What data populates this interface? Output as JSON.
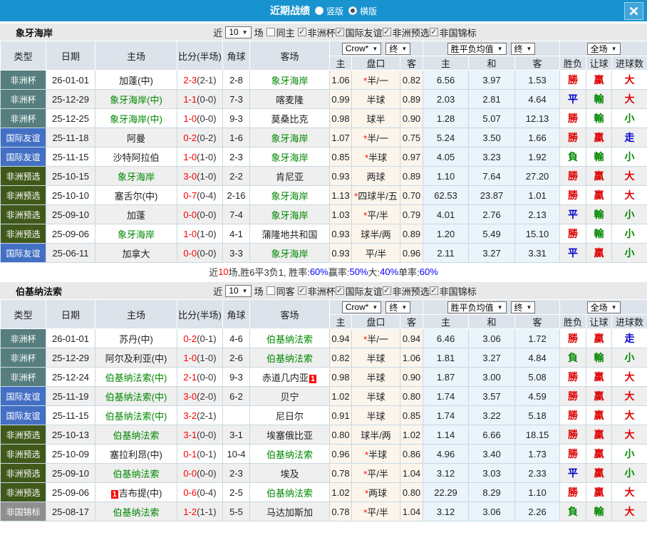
{
  "titlebar": {
    "title": "近期战绩",
    "radio_vertical": "竖版",
    "radio_horizontal": "横版"
  },
  "table_controls": {
    "odds_source": "Crow*",
    "odds_stage": "终",
    "mean_label": "胜平负均值",
    "mean_stage": "终",
    "scope": "全场",
    "dropdown_arrow": "▼"
  },
  "table_columns": {
    "type": "类型",
    "date": "日期",
    "home": "主场",
    "score": "比分(半场)",
    "corner": "角球",
    "away": "客场",
    "odds_home": "主",
    "handicap": "盘口",
    "odds_away": "客",
    "mean_home": "主",
    "mean_draw": "和",
    "mean_away": "客",
    "wdl": "胜负",
    "handicap_result": "让球",
    "goals": "进球数"
  },
  "colors": {
    "titlebar_bg": "#1993d0",
    "type_colors": {
      "非洲杯": "#567e7e",
      "国际友谊": "#4470c4",
      "非洲预选": "#40591b",
      "非国锦标": "#8f8f8f"
    },
    "result_colors": {
      "勝": "#dd0000",
      "贏": "#dd0000",
      "大": "#dd0000",
      "平": "#0000cc",
      "走": "#0000cc",
      "負": "#008800",
      "輸": "#008800",
      "小": "#008800"
    },
    "team_highlight": "#008800",
    "score_red": "#fe0000",
    "percent_blue": "#0000ff"
  },
  "sections": [
    {
      "team": "象牙海岸",
      "filter": {
        "near_label": "近",
        "count": "10",
        "games_label": "场",
        "same_label": "同主",
        "same_checked": false,
        "competitions": [
          {
            "label": "非洲杯",
            "checked": true
          },
          {
            "label": "国际友谊",
            "checked": true
          },
          {
            "label": "非洲预选",
            "checked": true
          },
          {
            "label": "非国锦标",
            "checked": true
          }
        ]
      },
      "rows": [
        {
          "type": "非洲杯",
          "date": "26-01-01",
          "home": "加蓬(中)",
          "home_green": false,
          "score": "2-3",
          "half": "(2-1)",
          "corner": "2-8",
          "away": "象牙海岸",
          "away_green": true,
          "o_home": "1.06",
          "star": true,
          "handicap": "半/一",
          "o_away": "0.82",
          "m_home": "6.56",
          "m_draw": "3.97",
          "m_away": "1.53",
          "r_wdl": "勝",
          "r_asia": "贏",
          "r_goal": "大"
        },
        {
          "type": "非洲杯",
          "date": "25-12-29",
          "home": "象牙海岸(中)",
          "home_green": true,
          "score": "1-1",
          "half": "(0-0)",
          "corner": "7-3",
          "away": "喀麦隆",
          "away_green": false,
          "o_home": "0.99",
          "star": false,
          "handicap": "半球",
          "o_away": "0.89",
          "m_home": "2.03",
          "m_draw": "2.81",
          "m_away": "4.64",
          "r_wdl": "平",
          "r_asia": "輸",
          "r_goal": "大"
        },
        {
          "type": "非洲杯",
          "date": "25-12-25",
          "home": "象牙海岸(中)",
          "home_green": true,
          "score": "1-0",
          "half": "(0-0)",
          "corner": "9-3",
          "away": "莫桑比克",
          "away_green": false,
          "o_home": "0.98",
          "star": false,
          "handicap": "球半",
          "o_away": "0.90",
          "m_home": "1.28",
          "m_draw": "5.07",
          "m_away": "12.13",
          "r_wdl": "勝",
          "r_asia": "輸",
          "r_goal": "小"
        },
        {
          "type": "国际友谊",
          "date": "25-11-18",
          "home": "阿曼",
          "home_green": false,
          "score": "0-2",
          "half": "(0-2)",
          "corner": "1-6",
          "away": "象牙海岸",
          "away_green": true,
          "o_home": "1.07",
          "star": true,
          "handicap": "半/一",
          "o_away": "0.75",
          "m_home": "5.24",
          "m_draw": "3.50",
          "m_away": "1.66",
          "r_wdl": "勝",
          "r_asia": "贏",
          "r_goal": "走"
        },
        {
          "type": "国际友谊",
          "date": "25-11-15",
          "home": "沙特阿拉伯",
          "home_green": false,
          "score": "1-0",
          "half": "(1-0)",
          "corner": "2-3",
          "away": "象牙海岸",
          "away_green": true,
          "o_home": "0.85",
          "star": true,
          "handicap": "半球",
          "o_away": "0.97",
          "m_home": "4.05",
          "m_draw": "3.23",
          "m_away": "1.92",
          "r_wdl": "負",
          "r_asia": "輸",
          "r_goal": "小"
        },
        {
          "type": "非洲预选",
          "date": "25-10-15",
          "home": "象牙海岸",
          "home_green": true,
          "score": "3-0",
          "half": "(1-0)",
          "corner": "2-2",
          "away": "肯尼亚",
          "away_green": false,
          "o_home": "0.93",
          "star": false,
          "handicap": "两球",
          "o_away": "0.89",
          "m_home": "1.10",
          "m_draw": "7.64",
          "m_away": "27.20",
          "r_wdl": "勝",
          "r_asia": "贏",
          "r_goal": "大"
        },
        {
          "type": "非洲预选",
          "date": "25-10-10",
          "home": "塞舌尔(中)",
          "home_green": false,
          "score": "0-7",
          "half": "(0-4)",
          "corner": "2-16",
          "away": "象牙海岸",
          "away_green": true,
          "o_home": "1.13",
          "star": true,
          "handicap": "四球半/五",
          "o_away": "0.70",
          "m_home": "62.53",
          "m_draw": "23.87",
          "m_away": "1.01",
          "r_wdl": "勝",
          "r_asia": "贏",
          "r_goal": "大"
        },
        {
          "type": "非洲预选",
          "date": "25-09-10",
          "home": "加蓬",
          "home_green": false,
          "score": "0-0",
          "half": "(0-0)",
          "corner": "7-4",
          "away": "象牙海岸",
          "away_green": true,
          "o_home": "1.03",
          "star": true,
          "handicap": "平/半",
          "o_away": "0.79",
          "m_home": "4.01",
          "m_draw": "2.76",
          "m_away": "2.13",
          "r_wdl": "平",
          "r_asia": "輸",
          "r_goal": "小"
        },
        {
          "type": "非洲预选",
          "date": "25-09-06",
          "home": "象牙海岸",
          "home_green": true,
          "score": "1-0",
          "half": "(1-0)",
          "corner": "4-1",
          "away": "蒲隆地共和国",
          "away_green": false,
          "o_home": "0.93",
          "star": false,
          "handicap": "球半/两",
          "o_away": "0.89",
          "m_home": "1.20",
          "m_draw": "5.49",
          "m_away": "15.10",
          "r_wdl": "勝",
          "r_asia": "輸",
          "r_goal": "小"
        },
        {
          "type": "国际友谊",
          "date": "25-06-11",
          "home": "加拿大",
          "home_green": false,
          "score": "0-0",
          "half": "(0-0)",
          "corner": "3-3",
          "away": "象牙海岸",
          "away_green": true,
          "o_home": "0.93",
          "star": false,
          "handicap": "平/半",
          "o_away": "0.96",
          "m_home": "2.11",
          "m_draw": "3.27",
          "m_away": "3.31",
          "r_wdl": "平",
          "r_asia": "贏",
          "r_goal": "小"
        }
      ],
      "summary": [
        {
          "t": "近",
          "c": "#333333"
        },
        {
          "t": "10",
          "c": "#ff0000"
        },
        {
          "t": "场,胜6平3负1, 胜率:",
          "c": "#333333"
        },
        {
          "t": "60%",
          "c": "#0000ff"
        },
        {
          "t": " 赢率:",
          "c": "#333333"
        },
        {
          "t": "50%",
          "c": "#0000ff"
        },
        {
          "t": " 大:",
          "c": "#333333"
        },
        {
          "t": "40%",
          "c": "#0000ff"
        },
        {
          "t": " 单率:",
          "c": "#333333"
        },
        {
          "t": "60%",
          "c": "#0000ff"
        }
      ]
    },
    {
      "team": "伯基纳法索",
      "filter": {
        "near_label": "近",
        "count": "10",
        "games_label": "场",
        "same_label": "同客",
        "same_checked": false,
        "competitions": [
          {
            "label": "非洲杯",
            "checked": true
          },
          {
            "label": "国际友谊",
            "checked": true
          },
          {
            "label": "非洲预选",
            "checked": true
          },
          {
            "label": "非国锦标",
            "checked": true
          }
        ]
      },
      "rows": [
        {
          "type": "非洲杯",
          "date": "26-01-01",
          "home": "苏丹(中)",
          "home_green": false,
          "score": "0-2",
          "half": "(0-1)",
          "corner": "4-6",
          "away": "伯基纳法索",
          "away_green": true,
          "o_home": "0.94",
          "star": true,
          "handicap": "半/一",
          "o_away": "0.94",
          "m_home": "6.46",
          "m_draw": "3.06",
          "m_away": "1.72",
          "r_wdl": "勝",
          "r_asia": "贏",
          "r_goal": "走"
        },
        {
          "type": "非洲杯",
          "date": "25-12-29",
          "home": "阿尔及利亚(中)",
          "home_green": false,
          "score": "1-0",
          "half": "(1-0)",
          "corner": "2-6",
          "away": "伯基纳法索",
          "away_green": true,
          "o_home": "0.82",
          "star": false,
          "handicap": "半球",
          "o_away": "1.06",
          "m_home": "1.81",
          "m_draw": "3.27",
          "m_away": "4.84",
          "r_wdl": "負",
          "r_asia": "輸",
          "r_goal": "小"
        },
        {
          "type": "非洲杯",
          "date": "25-12-24",
          "home": "伯基纳法索(中)",
          "home_green": true,
          "score": "2-1",
          "half": "(0-0)",
          "corner": "9-3",
          "away": "赤道几内亚",
          "away_green": false,
          "away_badge": "1",
          "o_home": "0.98",
          "star": false,
          "handicap": "半球",
          "o_away": "0.90",
          "m_home": "1.87",
          "m_draw": "3.00",
          "m_away": "5.08",
          "r_wdl": "勝",
          "r_asia": "贏",
          "r_goal": "大"
        },
        {
          "type": "国际友谊",
          "date": "25-11-19",
          "home": "伯基纳法索(中)",
          "home_green": true,
          "score": "3-0",
          "half": "(2-0)",
          "corner": "6-2",
          "away": "贝宁",
          "away_green": false,
          "o_home": "1.02",
          "star": false,
          "handicap": "半球",
          "o_away": "0.80",
          "m_home": "1.74",
          "m_draw": "3.57",
          "m_away": "4.59",
          "r_wdl": "勝",
          "r_asia": "贏",
          "r_goal": "大"
        },
        {
          "type": "国际友谊",
          "date": "25-11-15",
          "home": "伯基纳法索(中)",
          "home_green": true,
          "score": "3-2",
          "half": "(2-1)",
          "corner": "",
          "away": "尼日尔",
          "away_green": false,
          "o_home": "0.91",
          "star": false,
          "handicap": "半球",
          "o_away": "0.85",
          "m_home": "1.74",
          "m_draw": "3.22",
          "m_away": "5.18",
          "r_wdl": "勝",
          "r_asia": "贏",
          "r_goal": "大"
        },
        {
          "type": "非洲预选",
          "date": "25-10-13",
          "home": "伯基纳法索",
          "home_green": true,
          "score": "3-1",
          "half": "(0-0)",
          "corner": "3-1",
          "away": "埃塞俄比亚",
          "away_green": false,
          "o_home": "0.80",
          "star": false,
          "handicap": "球半/两",
          "o_away": "1.02",
          "m_home": "1.14",
          "m_draw": "6.66",
          "m_away": "18.15",
          "r_wdl": "勝",
          "r_asia": "贏",
          "r_goal": "大"
        },
        {
          "type": "非洲预选",
          "date": "25-10-09",
          "home": "塞拉利昂(中)",
          "home_green": false,
          "score": "0-1",
          "half": "(0-1)",
          "corner": "10-4",
          "away": "伯基纳法索",
          "away_green": true,
          "o_home": "0.96",
          "star": true,
          "handicap": "半球",
          "o_away": "0.86",
          "m_home": "4.96",
          "m_draw": "3.40",
          "m_away": "1.73",
          "r_wdl": "勝",
          "r_asia": "贏",
          "r_goal": "小"
        },
        {
          "type": "非洲预选",
          "date": "25-09-10",
          "home": "伯基纳法索",
          "home_green": true,
          "score": "0-0",
          "half": "(0-0)",
          "corner": "2-3",
          "away": "埃及",
          "away_green": false,
          "o_home": "0.78",
          "star": true,
          "handicap": "平/半",
          "o_away": "1.04",
          "m_home": "3.12",
          "m_draw": "3.03",
          "m_away": "2.33",
          "r_wdl": "平",
          "r_asia": "贏",
          "r_goal": "小"
        },
        {
          "type": "非洲预选",
          "date": "25-09-06",
          "home": "吉布提(中)",
          "home_green": false,
          "home_badge": "1",
          "home_badge_left": true,
          "score": "0-6",
          "half": "(0-4)",
          "corner": "2-5",
          "away": "伯基纳法索",
          "away_green": true,
          "o_home": "1.02",
          "star": true,
          "handicap": "两球",
          "o_away": "0.80",
          "m_home": "22.29",
          "m_draw": "8.29",
          "m_away": "1.10",
          "r_wdl": "勝",
          "r_asia": "贏",
          "r_goal": "大"
        },
        {
          "type": "非国锦标",
          "date": "25-08-17",
          "home": "伯基纳法索",
          "home_green": true,
          "score": "1-2",
          "half": "(1-1)",
          "corner": "5-5",
          "away": "马达加斯加",
          "away_green": false,
          "o_home": "0.78",
          "star": true,
          "handicap": "平/半",
          "o_away": "1.04",
          "m_home": "3.12",
          "m_draw": "3.06",
          "m_away": "2.26",
          "r_wdl": "負",
          "r_asia": "輸",
          "r_goal": "大"
        }
      ],
      "summary": null
    }
  ]
}
